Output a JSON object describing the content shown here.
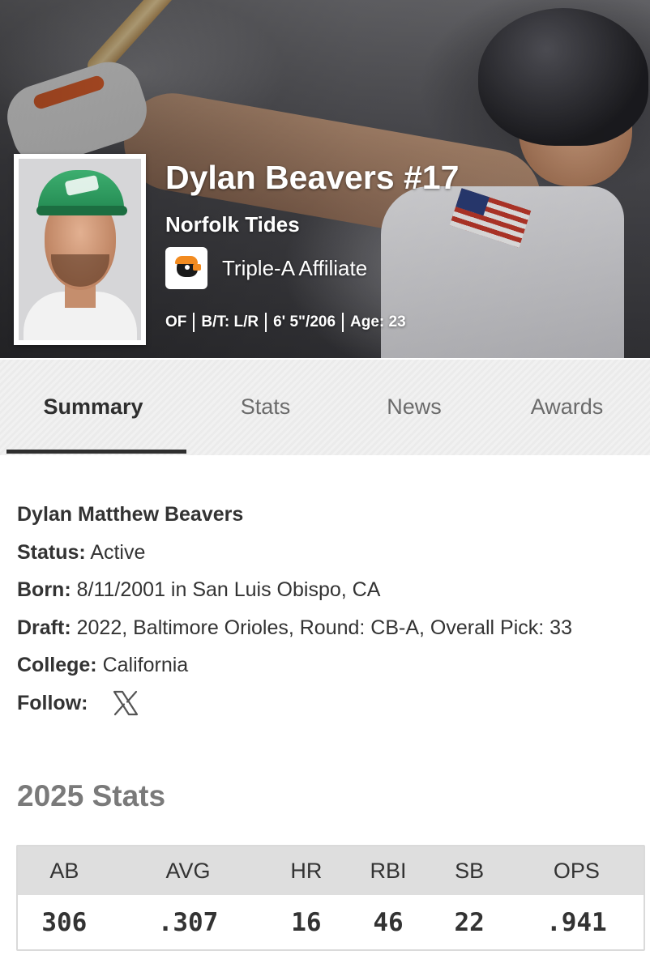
{
  "player": {
    "name_number": "Dylan Beavers #17",
    "team": "Norfolk Tides",
    "affiliate": "Triple-A Affiliate",
    "position": "OF",
    "bats_throws": "B/T: L/R",
    "height_weight": "6' 5\"/206",
    "age": "Age: 23"
  },
  "tabs": [
    "Summary",
    "Stats",
    "News",
    "Awards"
  ],
  "active_tab": "Summary",
  "details": {
    "full_name": "Dylan Matthew Beavers",
    "status_label": "Status:",
    "status_value": "Active",
    "born_label": "Born:",
    "born_value": "8/11/2001 in San Luis Obispo, CA",
    "draft_label": "Draft:",
    "draft_value": "2022, Baltimore Orioles, Round: CB-A, Overall Pick: 33",
    "college_label": "College:",
    "college_value": "California",
    "follow_label": "Follow:",
    "follow_icon": "x-logo-icon"
  },
  "stats_section": {
    "title": "2025 Stats",
    "headers": [
      "AB",
      "AVG",
      "HR",
      "RBI",
      "SB",
      "OPS"
    ],
    "values": [
      "306",
      ".307",
      "16",
      "46",
      "22",
      ".941"
    ]
  },
  "colors": {
    "tab_active": "#2e2e2e",
    "orioles_orange": "#f28b20",
    "table_header_bg": "#dedede"
  }
}
